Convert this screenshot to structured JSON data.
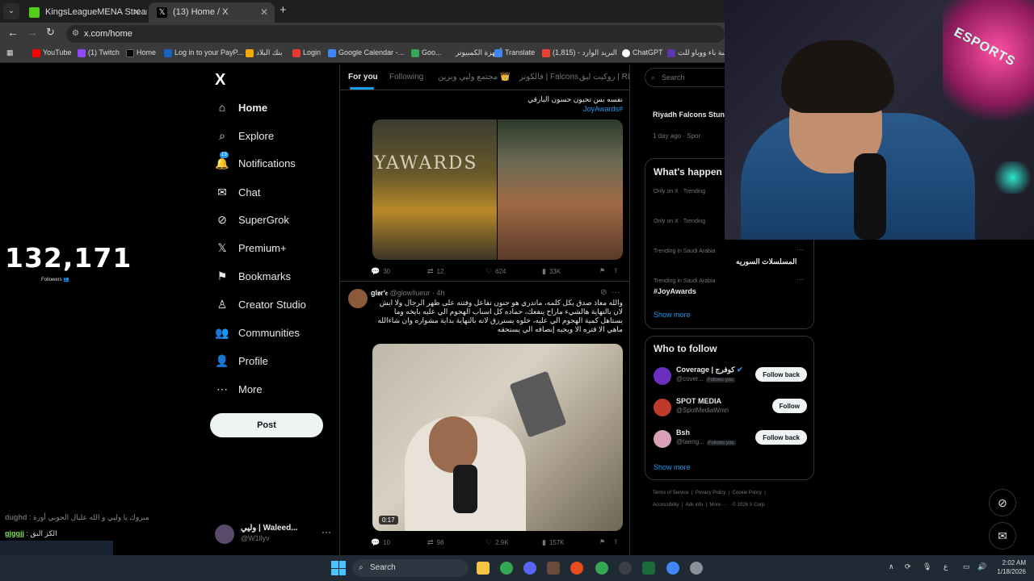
{
  "browser": {
    "tabs": [
      {
        "label": "KingsLeagueMENA Stream - W",
        "active": false
      },
      {
        "label": "(13) Home / X",
        "active": true
      }
    ],
    "new_tab_label": "+",
    "url": "x.com/home",
    "bookmarks": [
      {
        "label": "YouTube",
        "color": "#ff0000"
      },
      {
        "label": "(1) Twitch",
        "color": "#9146ff"
      },
      {
        "label": "Home",
        "color": "#000000"
      },
      {
        "label": "Log in to your PayP...",
        "color": "#1565c0"
      },
      {
        "label": "بنك البلاد",
        "color": "#f2a900"
      },
      {
        "label": "Login",
        "color": "#e53935"
      },
      {
        "label": "Google Calendar -...",
        "color": "#4285f4"
      },
      {
        "label": "Goo...",
        "color": "#34a853"
      },
      {
        "label": "أجهزة الكمبيوتر",
        "color": "#2196f3"
      },
      {
        "label": "Translate",
        "color": "#4285f4"
      },
      {
        "label": "البريد الوارد - (1,815)",
        "color": "#ea4335"
      },
      {
        "label": "ChatGPT",
        "color": "#ffffff"
      },
      {
        "label": "حبة باء ووباو للت...",
        "color": "#5e35b1"
      }
    ]
  },
  "stream": {
    "followers_count": "132,171",
    "followers_label": "Followers 👥",
    "chat": [
      {
        "user": "dughd",
        "message": "مبروك يا وليي و الله عليال الحوبي أورة"
      },
      {
        "user": "gjggjj",
        "message": "الكز البق"
      }
    ]
  },
  "x_nav": {
    "logo": "X",
    "items": [
      {
        "label": "Home",
        "icon": "home-icon",
        "glyph": "⌂",
        "active": true
      },
      {
        "label": "Explore",
        "icon": "search-icon",
        "glyph": "⌕"
      },
      {
        "label": "Notifications",
        "icon": "bell-icon",
        "glyph": "🔔",
        "badge": "13"
      },
      {
        "label": "Chat",
        "icon": "mail-icon",
        "glyph": "✉"
      },
      {
        "label": "SuperGrok",
        "icon": "grok-icon",
        "glyph": "⊘"
      },
      {
        "label": "Premium+",
        "icon": "x-premium-icon",
        "glyph": "𝕏"
      },
      {
        "label": "Bookmarks",
        "icon": "bookmark-icon",
        "glyph": "⚑"
      },
      {
        "label": "Creator Studio",
        "icon": "creator-studio-icon",
        "glyph": "♙"
      },
      {
        "label": "Communities",
        "icon": "communities-icon",
        "glyph": "👥"
      },
      {
        "label": "Profile",
        "icon": "profile-icon",
        "glyph": "👤"
      },
      {
        "label": "More",
        "icon": "more-icon",
        "glyph": "⋯"
      }
    ],
    "post_label": "Post",
    "account": {
      "name": "وليي | Waleed...",
      "handle": "@W1llyv",
      "more": "···"
    }
  },
  "timeline": {
    "tabs": [
      "For you",
      "Following",
      "مجتمع وليي وبرين 👑",
      "فالكونز | Falcons",
      "روكيت ليق | RL"
    ],
    "tweet1": {
      "text": "نفسه بس تحيون حسون البارقي",
      "hashtag": "#JoyAwards",
      "image_caption": "YAWARDS",
      "stats": {
        "replies": "30",
        "retweets": "12",
        "likes": "624",
        "views": "33K"
      }
    },
    "tweet2": {
      "author": "gl𝖔r'𝔢",
      "handle": "@glowllueur",
      "time": "· 4h",
      "text": "والله معاذ صدق بكل كلمه، ماتدري هو جنون تفاعل وفتنه على ظهر الرجال ولا ابش لان بالنهاية هالشيء ماراح ينفعك، حماده كل اسباب الهجوم الي عليه بايخه وما يستاهل كمية الهجوم الي عليه، خلوه يسترزق لانه بالنهاية بداية مشواره وان شاءالله ماهي الا فتره الا ويجيه إنصافه الي يستحقه",
      "video_time": "0:17",
      "stats": {
        "replies": "10",
        "retweets": "98",
        "likes": "2.9K",
        "views": "157K"
      }
    }
  },
  "sidebar": {
    "search_placeholder": "Search",
    "news": {
      "title": "Riyadh Falcons Stun in CDL Qualifiers Ups",
      "meta": "1 day ago · Spor"
    },
    "whats_happening": {
      "title": "What's happen",
      "trends": [
        {
          "meta": "Only on X · Trending",
          "name": ""
        },
        {
          "meta": "Only on X · Trending",
          "name": ""
        },
        {
          "meta": "Trending in Saudi Arabia",
          "name": "المسلسلات السوريه"
        },
        {
          "meta": "Trending in Saudi Arabia",
          "name": "#JoyAwards"
        }
      ],
      "show_more": "Show more"
    },
    "who_to_follow": {
      "title": "Who to follow",
      "accounts": [
        {
          "name": "Coverage | كوفرج",
          "handle": "@cover...",
          "follows_you": "Follows you",
          "button": "Follow back",
          "avatar_color": "#6a2fbf"
        },
        {
          "name": "SPOT MEDIA",
          "handle": "@SpotMediaWmn",
          "follows_you": "",
          "button": "Follow",
          "avatar_color": "#c0392b"
        },
        {
          "name": "Bsh",
          "handle": "@taeng...",
          "follows_you": "Follows you",
          "button": "Follow back",
          "avatar_color": "#d9a0b8"
        }
      ],
      "show_more": "Show more"
    },
    "footer": [
      "Terms of Service",
      "Privacy Policy",
      "Cookie Policy",
      "Accessibility",
      "Ads info",
      "More ···",
      "© 2026 X Corp."
    ]
  },
  "webcam": {
    "neon_text": "ESPORTS"
  },
  "taskbar": {
    "search_label": "Search",
    "time": "2:02 AM",
    "date": "1/18/2026",
    "lang": "ع"
  },
  "colors": {
    "accent": "#1d9bf0",
    "background": "#000000",
    "border": "#2f3336",
    "muted": "#71767b"
  }
}
